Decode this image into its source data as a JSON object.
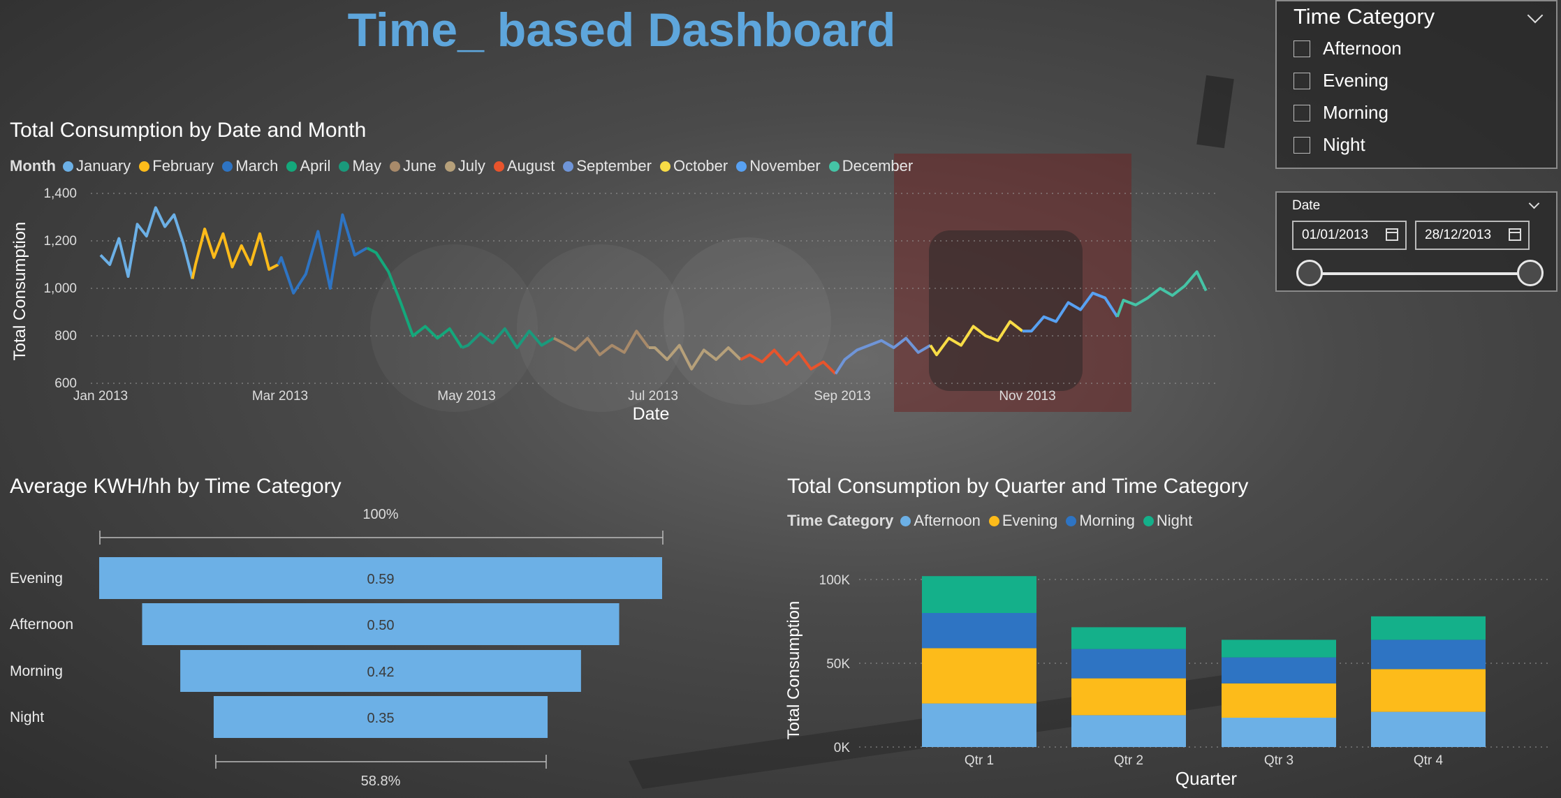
{
  "title": "Time_ based Dashboard",
  "line_chart": {
    "title": "Total Consumption by Date and Month",
    "legend_title": "Month",
    "xlabel": "Date",
    "ylabel": "Total Consumption",
    "y_ticks": [
      "1,400",
      "1,200",
      "1,000",
      "800",
      "600"
    ],
    "x_ticks": [
      "Jan 2013",
      "Mar 2013",
      "May 2013",
      "Jul 2013",
      "Sep 2013",
      "Nov 2013"
    ]
  },
  "funnel": {
    "title": "Average KWH/hh by Time Category",
    "top_pct": "100%",
    "bottom_pct": "58.8%"
  },
  "stacked": {
    "title": "Total Consumption by Quarter and Time Category",
    "legend_title": "Time Category",
    "xlabel": "Quarter",
    "ylabel": "Total Consumption",
    "y_ticks": [
      "100K",
      "50K",
      "0K"
    ]
  },
  "slicer_time": {
    "title": "Time Category",
    "options": [
      "Afternoon",
      "Evening",
      "Morning",
      "Night"
    ]
  },
  "slicer_date": {
    "title": "Date",
    "start": "01/01/2013",
    "end": "28/12/2013"
  },
  "chart_data": [
    {
      "type": "line",
      "title": "Total Consumption by Date and Month",
      "xlabel": "Date",
      "ylabel": "Total Consumption",
      "ylim": [
        600,
        1400
      ],
      "x_range": [
        "2013-01-01",
        "2013-12-28"
      ],
      "series": [
        {
          "name": "January",
          "color": "#6cb0e6",
          "x": [
            "2013-01-01",
            "2013-01-04",
            "2013-01-07",
            "2013-01-10",
            "2013-01-13",
            "2013-01-16",
            "2013-01-19",
            "2013-01-22",
            "2013-01-25",
            "2013-01-28",
            "2013-01-31"
          ],
          "values": [
            1140,
            1100,
            1210,
            1050,
            1270,
            1220,
            1340,
            1260,
            1310,
            1190,
            1040
          ]
        },
        {
          "name": "February",
          "color": "#fdbb1a",
          "x": [
            "2013-02-01",
            "2013-02-04",
            "2013-02-07",
            "2013-02-10",
            "2013-02-13",
            "2013-02-16",
            "2013-02-19",
            "2013-02-22",
            "2013-02-25",
            "2013-02-28"
          ],
          "values": [
            1100,
            1250,
            1130,
            1230,
            1090,
            1180,
            1100,
            1230,
            1080,
            1100
          ]
        },
        {
          "name": "March",
          "color": "#2e74c3",
          "x": [
            "2013-03-01",
            "2013-03-05",
            "2013-03-09",
            "2013-03-13",
            "2013-03-17",
            "2013-03-21",
            "2013-03-25",
            "2013-03-29"
          ],
          "values": [
            1130,
            980,
            1060,
            1240,
            1000,
            1310,
            1140,
            1170
          ]
        },
        {
          "name": "April",
          "color": "#14a87b",
          "x": [
            "2013-04-01",
            "2013-04-05",
            "2013-04-09",
            "2013-04-13",
            "2013-04-17",
            "2013-04-21",
            "2013-04-25",
            "2013-04-29"
          ],
          "values": [
            1150,
            1070,
            940,
            800,
            840,
            790,
            830,
            750
          ]
        },
        {
          "name": "May",
          "color": "#1a9a7c",
          "x": [
            "2013-05-01",
            "2013-05-05",
            "2013-05-09",
            "2013-05-13",
            "2013-05-17",
            "2013-05-21",
            "2013-05-25",
            "2013-05-29"
          ],
          "values": [
            760,
            810,
            770,
            830,
            750,
            820,
            760,
            790
          ]
        },
        {
          "name": "June",
          "color": "#a88a6a",
          "x": [
            "2013-06-01",
            "2013-06-05",
            "2013-06-09",
            "2013-06-13",
            "2013-06-17",
            "2013-06-21",
            "2013-06-25",
            "2013-06-29"
          ],
          "values": [
            770,
            740,
            790,
            720,
            760,
            730,
            820,
            750
          ]
        },
        {
          "name": "July",
          "color": "#b6a07a",
          "x": [
            "2013-07-01",
            "2013-07-05",
            "2013-07-09",
            "2013-07-13",
            "2013-07-17",
            "2013-07-21",
            "2013-07-25",
            "2013-07-29"
          ],
          "values": [
            750,
            700,
            760,
            660,
            740,
            700,
            750,
            700
          ]
        },
        {
          "name": "August",
          "color": "#e8542c",
          "x": [
            "2013-08-01",
            "2013-08-05",
            "2013-08-09",
            "2013-08-13",
            "2013-08-17",
            "2013-08-21",
            "2013-08-25",
            "2013-08-29"
          ],
          "values": [
            720,
            690,
            740,
            680,
            730,
            660,
            690,
            640
          ]
        },
        {
          "name": "September",
          "color": "#6f95d8",
          "x": [
            "2013-09-01",
            "2013-09-05",
            "2013-09-09",
            "2013-09-13",
            "2013-09-17",
            "2013-09-21",
            "2013-09-25",
            "2013-09-29"
          ],
          "values": [
            700,
            740,
            760,
            780,
            750,
            790,
            730,
            760
          ]
        },
        {
          "name": "October",
          "color": "#f8dc46",
          "x": [
            "2013-10-01",
            "2013-10-05",
            "2013-10-09",
            "2013-10-13",
            "2013-10-17",
            "2013-10-21",
            "2013-10-25",
            "2013-10-29"
          ],
          "values": [
            720,
            790,
            760,
            840,
            800,
            780,
            860,
            820
          ]
        },
        {
          "name": "November",
          "color": "#58a1f2",
          "x": [
            "2013-11-01",
            "2013-11-05",
            "2013-11-09",
            "2013-11-13",
            "2013-11-17",
            "2013-11-21",
            "2013-11-25",
            "2013-11-29"
          ],
          "values": [
            820,
            880,
            860,
            940,
            910,
            980,
            960,
            880
          ]
        },
        {
          "name": "December",
          "color": "#45c4a6",
          "x": [
            "2013-12-01",
            "2013-12-05",
            "2013-12-09",
            "2013-12-13",
            "2013-12-17",
            "2013-12-21",
            "2013-12-25",
            "2013-12-28"
          ],
          "values": [
            950,
            930,
            960,
            1000,
            970,
            1010,
            1070,
            990
          ]
        }
      ]
    },
    {
      "type": "bar",
      "title": "Average KWH/hh by Time Category",
      "categories": [
        "Evening",
        "Afternoon",
        "Morning",
        "Night"
      ],
      "values": [
        0.59,
        0.5,
        0.42,
        0.35
      ],
      "labels": [
        "0.59",
        "0.50",
        "0.42",
        "0.35"
      ],
      "color": "#6cb0e6"
    },
    {
      "type": "bar",
      "title": "Total Consumption by Quarter and Time Category",
      "xlabel": "Quarter",
      "ylabel": "Total Consumption",
      "ylim": [
        0,
        100000
      ],
      "categories": [
        "Qtr 1",
        "Qtr 2",
        "Qtr 3",
        "Qtr 4"
      ],
      "series": [
        {
          "name": "Afternoon",
          "color": "#6cb0e6",
          "values": [
            26000,
            19000,
            17500,
            21000
          ]
        },
        {
          "name": "Evening",
          "color": "#fdbb1a",
          "values": [
            33000,
            22000,
            20500,
            25500
          ]
        },
        {
          "name": "Morning",
          "color": "#2e74c3",
          "values": [
            21000,
            17500,
            15500,
            17500
          ]
        },
        {
          "name": "Night",
          "color": "#14b08a",
          "values": [
            22000,
            13000,
            10500,
            14000
          ]
        }
      ]
    }
  ]
}
